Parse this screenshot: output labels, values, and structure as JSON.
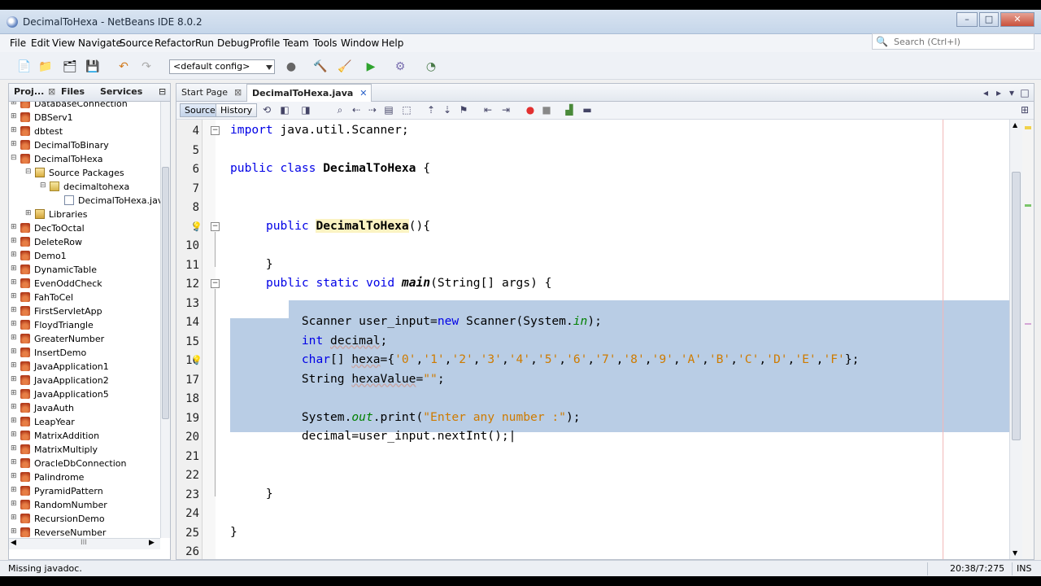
{
  "window": {
    "title": "DecimalToHexa - NetBeans IDE 8.0.2"
  },
  "menu": [
    "File",
    "Edit",
    "View",
    "Navigate",
    "Source",
    "Refactor",
    "Run",
    "Debug",
    "Profile",
    "Team",
    "Tools",
    "Window",
    "Help"
  ],
  "search": {
    "placeholder": "Search (Ctrl+I)"
  },
  "toolbar": {
    "config": "<default config>"
  },
  "left_panel": {
    "tabs": [
      "Proj...",
      "Files",
      "Services"
    ],
    "tree": [
      {
        "label": "DatabaseConnection",
        "icon": "project"
      },
      {
        "label": "DBServ1",
        "icon": "web-project"
      },
      {
        "label": "dbtest",
        "icon": "project"
      },
      {
        "label": "DecimalToBinary",
        "icon": "project"
      },
      {
        "label": "DecimalToHexa",
        "icon": "project"
      },
      {
        "label": "Source Packages",
        "icon": "source-packages"
      },
      {
        "label": "decimaltohexa",
        "icon": "package"
      },
      {
        "label": "DecimalToHexa.java",
        "icon": "java-file"
      },
      {
        "label": "Libraries",
        "icon": "libraries"
      },
      {
        "label": "DecToOctal",
        "icon": "project"
      },
      {
        "label": "DeleteRow",
        "icon": "web-project"
      },
      {
        "label": "Demo1",
        "icon": "web-project"
      },
      {
        "label": "DynamicTable",
        "icon": "web-project"
      },
      {
        "label": "EvenOddCheck",
        "icon": "project"
      },
      {
        "label": "FahToCel",
        "icon": "project"
      },
      {
        "label": "FirstServletApp",
        "icon": "web-project"
      },
      {
        "label": "FloydTriangle",
        "icon": "project"
      },
      {
        "label": "GreaterNumber",
        "icon": "project"
      },
      {
        "label": "InsertDemo",
        "icon": "web-project"
      },
      {
        "label": "JavaApplication1",
        "icon": "project"
      },
      {
        "label": "JavaApplication2",
        "icon": "project"
      },
      {
        "label": "JavaApplication5",
        "icon": "project"
      },
      {
        "label": "JavaAuth",
        "icon": "project"
      },
      {
        "label": "LeapYear",
        "icon": "project"
      },
      {
        "label": "MatrixAddition",
        "icon": "project"
      },
      {
        "label": "MatrixMultiply",
        "icon": "project"
      },
      {
        "label": "OracleDbConnection",
        "icon": "project"
      },
      {
        "label": "Palindrome",
        "icon": "project"
      },
      {
        "label": "PyramidPattern",
        "icon": "project"
      },
      {
        "label": "RandomNumber",
        "icon": "project"
      },
      {
        "label": "RecursionDemo",
        "icon": "project"
      },
      {
        "label": "ReverseNumber",
        "icon": "project"
      }
    ],
    "hscroll_glyph": "III"
  },
  "editor": {
    "tabs": [
      {
        "label": "Start Page",
        "active": false
      },
      {
        "label": "DecimalToHexa.java",
        "active": true
      }
    ],
    "source_label": "Source",
    "history_label": "History",
    "line_numbers": [
      "4",
      "5",
      "6",
      "7",
      "8",
      "9",
      "10",
      "11",
      "12",
      "13",
      "14",
      "15",
      "16",
      "17",
      "18",
      "19",
      "20",
      "21",
      "22",
      "23",
      "24",
      "25",
      "26"
    ]
  },
  "status": {
    "message": "Missing javadoc.",
    "position": "20:38/7:275",
    "mode": "INS"
  }
}
